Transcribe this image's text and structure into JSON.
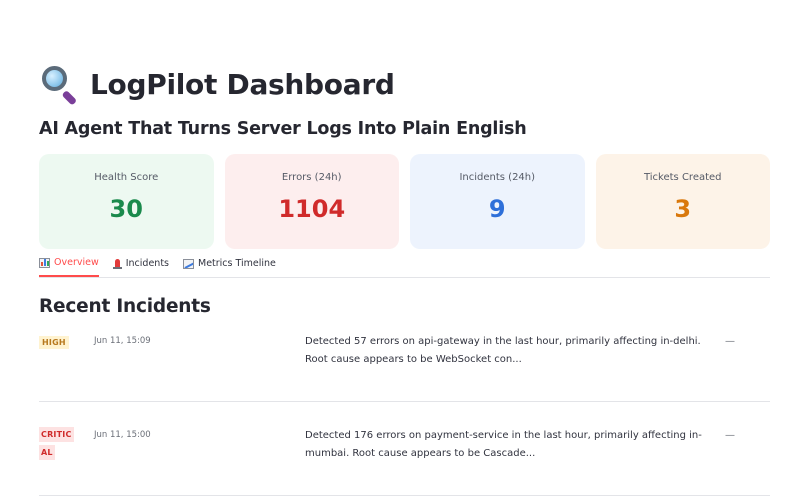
{
  "header": {
    "title": "LogPilot Dashboard",
    "title_icon": "magnifying-glass-icon",
    "subtitle": "AI Agent That Turns Server Logs Into Plain English"
  },
  "metrics": [
    {
      "label": "Health Score",
      "value": "30",
      "color": "#1a8a4c"
    },
    {
      "label": "Errors (24h)",
      "value": "1104",
      "color": "#d02b2b"
    },
    {
      "label": "Incidents (24h)",
      "value": "9",
      "color": "#2e6fd9"
    },
    {
      "label": "Tickets Created",
      "value": "3",
      "color": "#d9780c"
    }
  ],
  "tabs": [
    {
      "label": "Overview",
      "icon": "bar-chart-icon",
      "active": true
    },
    {
      "label": "Incidents",
      "icon": "siren-icon",
      "active": false
    },
    {
      "label": "Metrics Timeline",
      "icon": "line-chart-icon",
      "active": false
    }
  ],
  "section": {
    "title": "Recent Incidents"
  },
  "incidents": [
    {
      "severity": "HIGH",
      "time": "Jun 11, 15:09",
      "description": "Detected 57 errors on api-gateway in the last hour, primarily affecting in-delhi. Root cause appears to be WebSocket con...",
      "ticket": "—"
    },
    {
      "severity": "CRITICAL",
      "time": "Jun 11, 15:00",
      "description": "Detected 176 errors on payment-service in the last hour, primarily affecting in-mumbai. Root cause appears to be Cascade...",
      "ticket": "—"
    }
  ],
  "colors": {
    "accent": "#ff4b4b",
    "severity_high": "#b7791f",
    "severity_critical": "#d02b2b"
  }
}
